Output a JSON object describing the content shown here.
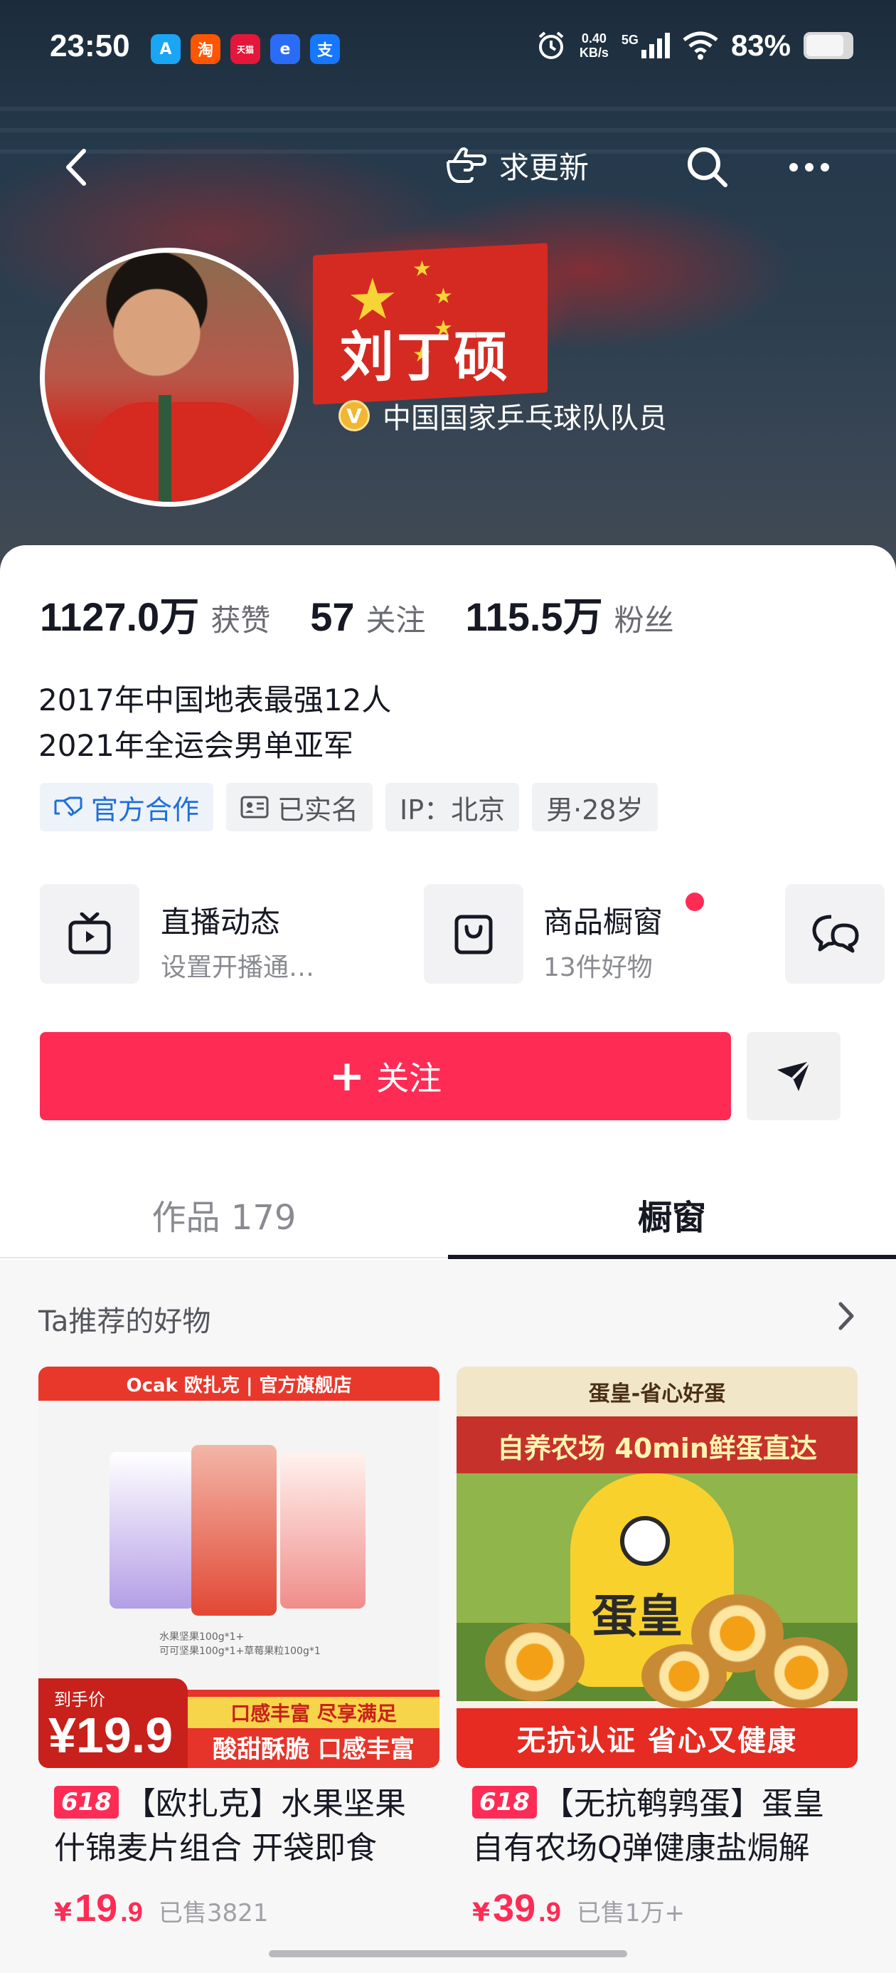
{
  "status_bar": {
    "time": "23:50",
    "apps": [
      {
        "name": "alipay-a-icon",
        "glyph": "A",
        "color": "#1aa5f5"
      },
      {
        "name": "taobao-icon",
        "glyph": "淘",
        "color": "#ff5500"
      },
      {
        "name": "tmall-icon",
        "glyph": "天猫",
        "color": "#e4163a"
      },
      {
        "name": "chat-app-icon",
        "glyph": "e",
        "color": "#2a6cf6"
      },
      {
        "name": "alipay-icon",
        "glyph": "支",
        "color": "#1677ff"
      }
    ],
    "net_speed_value": "0.40",
    "net_speed_unit": "KB/s",
    "network": "5G",
    "battery": "83%",
    "battery_level": 0.83
  },
  "nav": {
    "request_update": "求更新"
  },
  "profile": {
    "name": "刘丁硕",
    "verify_badge": "V",
    "verification": "中国国家乒乓球队队员"
  },
  "stats": [
    {
      "value": "1127.0万",
      "label": "获赞"
    },
    {
      "value": "57",
      "label": "关注"
    },
    {
      "value": "115.5万",
      "label": "粉丝"
    }
  ],
  "bio": {
    "line1": "2017年中国地表最强12人",
    "line2": "2021年全运会男单亚军"
  },
  "tags": {
    "official": "官方合作",
    "real_name": "已实名",
    "ip": "IP：北京",
    "gender_age": "男·28岁"
  },
  "features": {
    "live_title": "直播动态",
    "live_sub": "设置开播通…",
    "shop_title": "商品橱窗",
    "shop_sub": "13件好物"
  },
  "actions": {
    "follow": "关注"
  },
  "tabs": {
    "works": "作品 179",
    "showcase": "橱窗"
  },
  "shelf": {
    "header": "Ta推荐的好物",
    "products": [
      {
        "badge": "618",
        "title": "【欧扎克】水果坚果什锦麦片组合 开袋即食",
        "price_currency": "¥",
        "price_int": "19",
        "price_dec": ".9",
        "sold": "已售3821",
        "image_text": {
          "brand": "Ocak 欧扎克 | 官方旗舰店",
          "price_label": "到手价",
          "price": "¥19.9",
          "slogan1": "口感丰富 尽享满足",
          "slogan2": "酸甜酥脆 口感丰富",
          "small1": "水果坚果100g*1+",
          "small2": "可可坚果100g*1+草莓果粒100g*1"
        }
      },
      {
        "badge": "618",
        "title": "【无抗鹌鹑蛋】蛋皇自有农场Q弹健康盐焗解",
        "price_currency": "¥",
        "price_int": "39",
        "price_dec": ".9",
        "sold": "已售1万+",
        "image_text": {
          "top": "蛋皇-省心好蛋",
          "red": "自养农场 40min鲜蛋直达",
          "mascot": "蛋皇",
          "bottom": "无抗认证 省心又健康"
        }
      }
    ]
  }
}
